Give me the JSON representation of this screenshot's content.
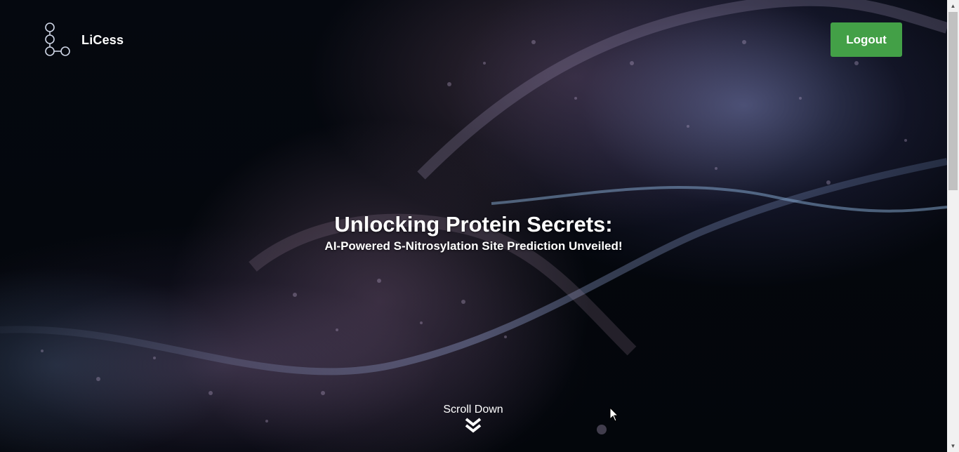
{
  "header": {
    "logo_text": "LiCess",
    "logout_label": "Logout"
  },
  "hero": {
    "title": "Unlocking Protein Secrets:",
    "subtitle": "AI-Powered S-Nitrosylation Site Prediction Unveiled!"
  },
  "scroll": {
    "label": "Scroll Down",
    "icon": "double-chevron-down-icon"
  },
  "colors": {
    "logout_button": "#43a047",
    "text": "#ffffff",
    "background": "#04070d"
  }
}
